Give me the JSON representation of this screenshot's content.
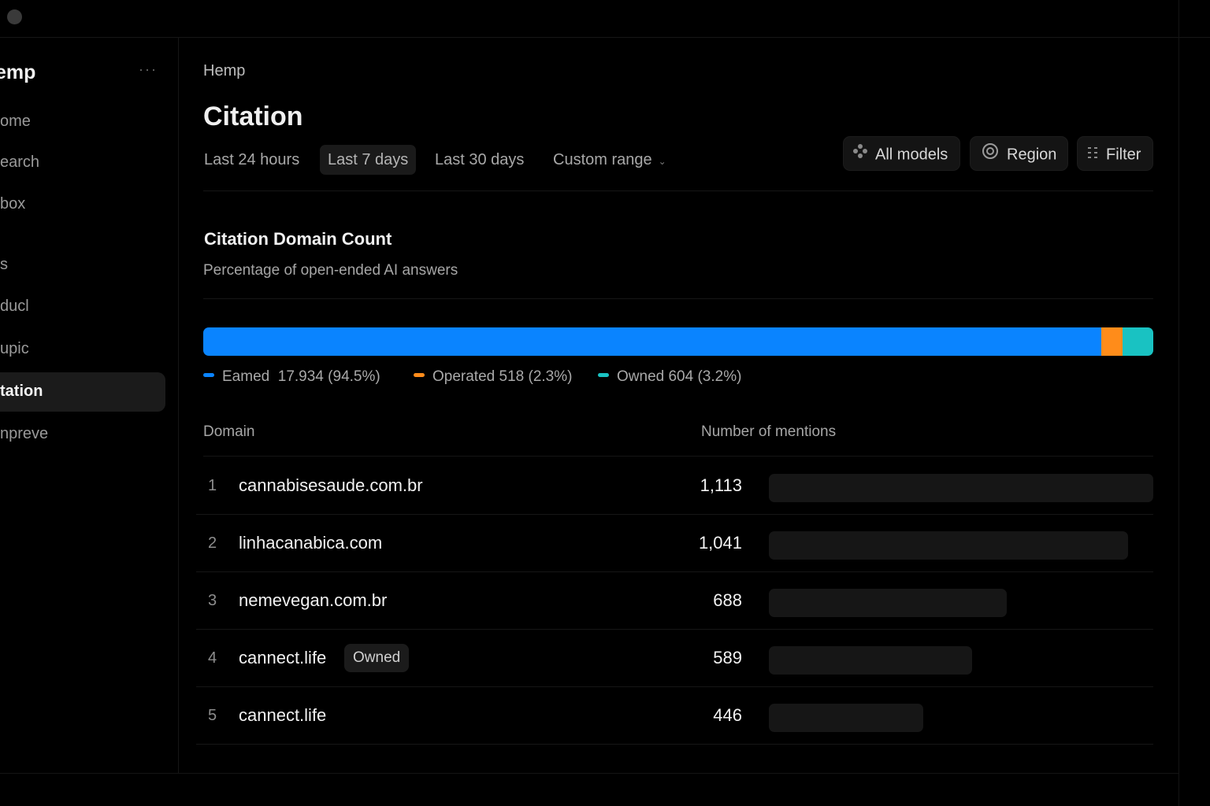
{
  "sidebar": {
    "workspace": "emp",
    "more": "···",
    "items": [
      {
        "label": "ome"
      },
      {
        "label": "earch"
      },
      {
        "label": "box"
      },
      {
        "label": "s"
      },
      {
        "label": "ducl"
      },
      {
        "label": "upic"
      },
      {
        "label": "tation",
        "active": true
      },
      {
        "label": "npreve"
      }
    ]
  },
  "header": {
    "breadcrumb": "Hemp",
    "title": "Citation"
  },
  "time_tabs": [
    {
      "label": "Last 24 hours"
    },
    {
      "label": "Last 7 days",
      "active": true
    },
    {
      "label": "Last 30 days"
    },
    {
      "label": "Custom range"
    }
  ],
  "filters": {
    "models": "All models",
    "region": "Region",
    "filter": "Filter"
  },
  "section": {
    "title": "Citation Domain Count",
    "subtitle": "Percentage of open-ended AI answers"
  },
  "breakdown": [
    {
      "label": "Eamed",
      "value": "17.934",
      "pct": "(94.5%)",
      "share": 94.5,
      "color": "#0a84ff"
    },
    {
      "label": "Operated",
      "value": "518",
      "pct": "(2.3%)",
      "share": 2.3,
      "color": "#ff8c1a"
    },
    {
      "label": "Owned",
      "value": "604",
      "pct": "(3.2%)",
      "share": 3.2,
      "color": "#19c2c2"
    }
  ],
  "table": {
    "col_domain": "Domain",
    "col_mentions": "Number of mentions",
    "rows": [
      {
        "rank": "1",
        "domain": "cannabisesaude.com.br",
        "mentions": "1,113",
        "value": 1113,
        "badge": ""
      },
      {
        "rank": "2",
        "domain": "linhacanabica.com",
        "mentions": "1,041",
        "value": 1041,
        "badge": ""
      },
      {
        "rank": "3",
        "domain": "nemevegan.com.br",
        "mentions": "688",
        "value": 688,
        "badge": ""
      },
      {
        "rank": "4",
        "domain": "cannect.life",
        "mentions": "589",
        "value": 589,
        "badge": "Owned"
      },
      {
        "rank": "5",
        "domain": "cannect.life",
        "mentions": "446",
        "value": 446,
        "badge": ""
      }
    ]
  },
  "colors": {
    "background": "#000000",
    "earned": "#0a84ff",
    "operated": "#ff8c1a",
    "owned": "#19c2c2"
  }
}
